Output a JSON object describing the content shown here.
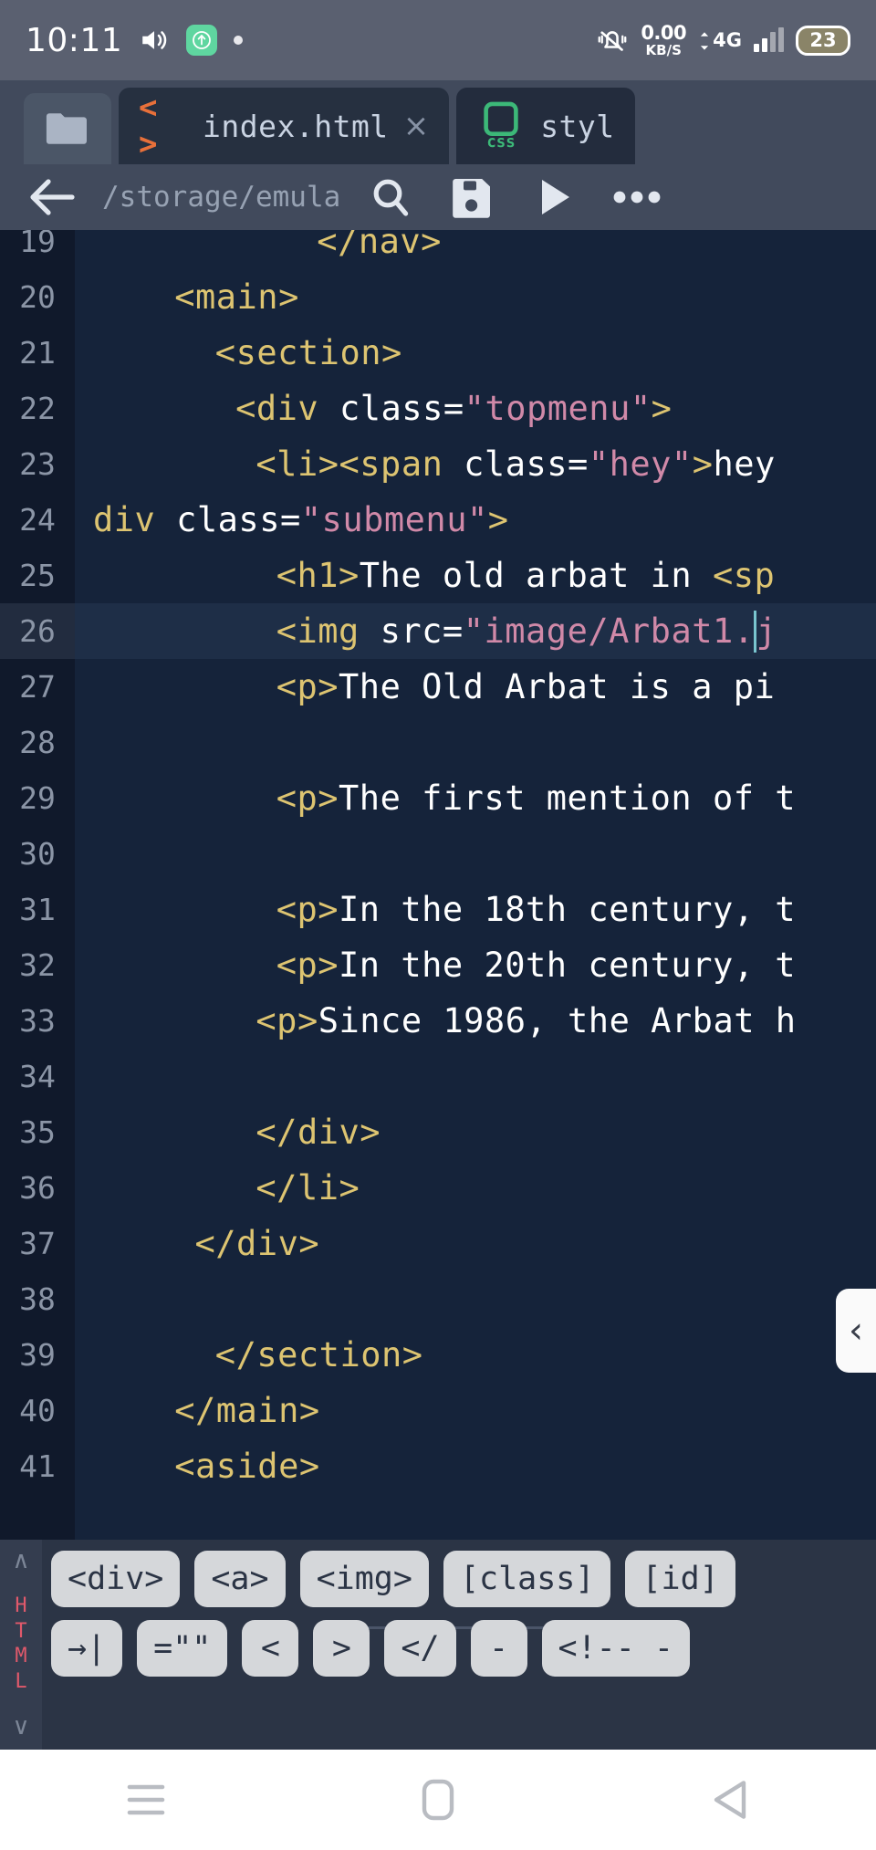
{
  "statusbar": {
    "clock": "10:11",
    "volume_icon": "volume-icon",
    "upload_icon": "upload-arrow-icon",
    "dot_icon": "recording-dot-icon",
    "mute_icon": "bell-muted-icon",
    "netspeed_value": "0.00",
    "netspeed_unit": "KB/S",
    "network_type": "4G",
    "battery_level": "23"
  },
  "tabs": {
    "folder_icon": "folder-icon",
    "items": [
      {
        "name": "index.html",
        "lang": "html",
        "lang_glyph": "< >",
        "active": true,
        "close": "×"
      },
      {
        "name": "styl",
        "lang": "css",
        "lang_glyph": "css",
        "active": false,
        "close": ""
      }
    ]
  },
  "toolbar": {
    "back_icon": "back-arrow-icon",
    "path": "/storage/emula",
    "search_icon": "search-icon",
    "save_icon": "save-icon",
    "run_icon": "run-icon",
    "more_icon": "overflow-menu-icon"
  },
  "editor": {
    "current_line": 26,
    "colors": {
      "background": "#15233a",
      "gutter": "#10192b",
      "tag": "#ddc471",
      "attribute": "#ffffff",
      "value": "#d089a8",
      "text": "#ffffff",
      "current_line_bg": "#1e2e47",
      "caret": "#79c5cf"
    },
    "lines": [
      {
        "n": "19",
        "indent": 11,
        "tokens": [
          {
            "t": "tag",
            "v": "</nav>"
          }
        ]
      },
      {
        "n": "20",
        "indent": 4,
        "tokens": [
          {
            "t": "tag",
            "v": "<main>"
          }
        ]
      },
      {
        "n": "21",
        "indent": 6,
        "tokens": [
          {
            "t": "tag",
            "v": "<section>"
          }
        ]
      },
      {
        "n": "22",
        "indent": 7,
        "tokens": [
          {
            "t": "tag",
            "v": "<div "
          },
          {
            "t": "attr",
            "v": "class="
          },
          {
            "t": "val",
            "v": "\"topmenu\""
          },
          {
            "t": "tag",
            "v": ">"
          }
        ]
      },
      {
        "n": "23",
        "indent": 8,
        "tokens": [
          {
            "t": "tag",
            "v": "<li><span "
          },
          {
            "t": "attr",
            "v": "class="
          },
          {
            "t": "val",
            "v": "\"hey\""
          },
          {
            "t": "tag",
            "v": ">"
          },
          {
            "t": "text",
            "v": "hey"
          }
        ]
      },
      {
        "n": "24",
        "indent": 0,
        "tokens": [
          {
            "t": "tag",
            "v": "div "
          },
          {
            "t": "attr",
            "v": "class="
          },
          {
            "t": "val",
            "v": "\"submenu\""
          },
          {
            "t": "tag",
            "v": ">"
          }
        ]
      },
      {
        "n": "25",
        "indent": 9,
        "tokens": [
          {
            "t": "tag",
            "v": "<h1>"
          },
          {
            "t": "text",
            "v": "The old arbat in "
          },
          {
            "t": "tag",
            "v": "<sp"
          }
        ]
      },
      {
        "n": "26",
        "indent": 9,
        "current": true,
        "tokens": [
          {
            "t": "tag",
            "v": "<img "
          },
          {
            "t": "attr",
            "v": "src="
          },
          {
            "t": "val",
            "v": "\"image/Arbat1."
          },
          {
            "t": "caret",
            "v": ""
          },
          {
            "t": "val",
            "v": "j"
          }
        ]
      },
      {
        "n": "27",
        "indent": 9,
        "tokens": [
          {
            "t": "tag",
            "v": "<p>"
          },
          {
            "t": "text",
            "v": "The Old Arbat is a pi"
          }
        ]
      },
      {
        "n": "28",
        "indent": 0,
        "tokens": []
      },
      {
        "n": "29",
        "indent": 9,
        "tokens": [
          {
            "t": "tag",
            "v": "<p>"
          },
          {
            "t": "text",
            "v": "The first mention of t"
          }
        ]
      },
      {
        "n": "30",
        "indent": 0,
        "tokens": []
      },
      {
        "n": "31",
        "indent": 9,
        "tokens": [
          {
            "t": "tag",
            "v": "<p>"
          },
          {
            "t": "text",
            "v": "In the 18th century, t"
          }
        ]
      },
      {
        "n": "32",
        "indent": 9,
        "tokens": [
          {
            "t": "tag",
            "v": "<p>"
          },
          {
            "t": "text",
            "v": "In the 20th century, t"
          }
        ]
      },
      {
        "n": "33",
        "indent": 8,
        "tokens": [
          {
            "t": "tag",
            "v": "<p>"
          },
          {
            "t": "text",
            "v": "Since 1986, the Arbat h"
          }
        ]
      },
      {
        "n": "34",
        "indent": 0,
        "tokens": []
      },
      {
        "n": "35",
        "indent": 8,
        "tokens": [
          {
            "t": "tag",
            "v": "</div>"
          }
        ]
      },
      {
        "n": "36",
        "indent": 8,
        "tokens": [
          {
            "t": "tag",
            "v": "</li>"
          }
        ]
      },
      {
        "n": "37",
        "indent": 5,
        "tokens": [
          {
            "t": "tag",
            "v": "</div>"
          }
        ]
      },
      {
        "n": "38",
        "indent": 0,
        "tokens": []
      },
      {
        "n": "39",
        "indent": 6,
        "tokens": [
          {
            "t": "tag",
            "v": "</section>"
          }
        ]
      },
      {
        "n": "40",
        "indent": 4,
        "tokens": [
          {
            "t": "tag",
            "v": "</main>"
          }
        ]
      },
      {
        "n": "41",
        "indent": 4,
        "tokens": [
          {
            "t": "tag",
            "v": "<aside>"
          }
        ]
      }
    ]
  },
  "side_handle": {
    "glyph": "‹",
    "name": "panel-expand-handle"
  },
  "keyboard": {
    "lang_label": "HTML",
    "up_glyph": "∧",
    "down_glyph": "∨",
    "row1": [
      {
        "label": "<div>",
        "name": "key-div"
      },
      {
        "label": "<a>",
        "name": "key-a"
      },
      {
        "label": "<img>",
        "name": "key-img"
      },
      {
        "label": "[class]",
        "name": "key-class"
      },
      {
        "label": "[id]",
        "name": "key-id"
      }
    ],
    "row2": [
      {
        "label": "→|",
        "name": "key-tab"
      },
      {
        "label": "=\"\"",
        "name": "key-equals-quotes"
      },
      {
        "label": "<",
        "name": "key-less-than"
      },
      {
        "label": ">",
        "name": "key-greater-than"
      },
      {
        "label": "</",
        "name": "key-close-tag"
      },
      {
        "label": "-",
        "name": "key-hyphen"
      },
      {
        "label": "<!-- -",
        "name": "key-comment"
      }
    ]
  },
  "navbar": {
    "recents_icon": "recents-icon",
    "home_icon": "home-icon",
    "back_icon": "back-triangle-icon"
  }
}
